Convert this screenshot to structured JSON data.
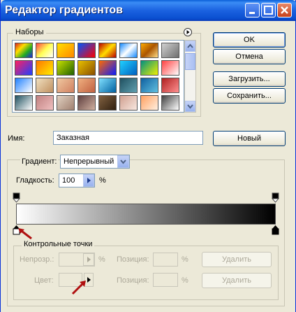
{
  "title": "Редактор градиентов",
  "presets": {
    "label": "Наборы",
    "swatches": [
      [
        "#d22,#fd0,#2a2,#22d",
        "#f44,#ff5,#fff",
        "#ffe000,#ff8800",
        "#0055ff,#ff0000",
        "#b00,#fd0,#b00",
        "#18f,#fff,#18f",
        "#fa0,#a50,#fd8",
        "#d0d0d0,#707070"
      ],
      [
        "#ff2060,#2040ff",
        "#ff7700,#ffee00",
        "#c8e000,#206000",
        "#e8c000,#8a4f00",
        "#ff6a00,#0a1aff",
        "#20d0ff,#0060c0",
        "#009080,#f0f000",
        "#ff4040,#ffffff"
      ],
      [
        "#2080ff,#ffffff",
        "#f0e0c0,#c09060",
        "#f0c8a0,#d08060",
        "#f0b080,#c06040",
        "#80e0ff,#0060a0",
        "#205060,#60a0b0",
        "#1060a0,#60c0e0",
        "#b02020,#ff9090"
      ],
      [
        "#205060,#ffffff",
        "#c08080,#f0c0c0",
        "#e0d0c0,#a08070",
        "#604040,#d0b0a0",
        "#806040,#302010",
        "#d0a090,#f8e8e0",
        "#ffa060,#fff0e0",
        "#404040,#ffffff"
      ]
    ]
  },
  "buttons": {
    "ok": "OK",
    "cancel": "Отмена",
    "load": "Загрузить...",
    "save": "Сохранить...",
    "new": "Новый",
    "delete1": "Удалить",
    "delete2": "Удалить"
  },
  "name": {
    "label": "Имя:",
    "value": "Заказная"
  },
  "gradient": {
    "type_label": "Градиент:",
    "type_value": "Непрерывный",
    "smoothness_label": "Гладкость:",
    "smoothness_value": "100",
    "smoothness_unit": "%"
  },
  "stops": {
    "label": "Контрольные точки",
    "opacity_label": "Непрозр.:",
    "opacity_unit": "%",
    "position_label1": "Позиция:",
    "position_unit1": "%",
    "color_label": "Цвет:",
    "position_label2": "Позиция:",
    "position_unit2": "%"
  },
  "colors": {
    "gradient_start": "#ffffff",
    "gradient_end": "#000000",
    "annotation_arrow": "#b01010"
  }
}
